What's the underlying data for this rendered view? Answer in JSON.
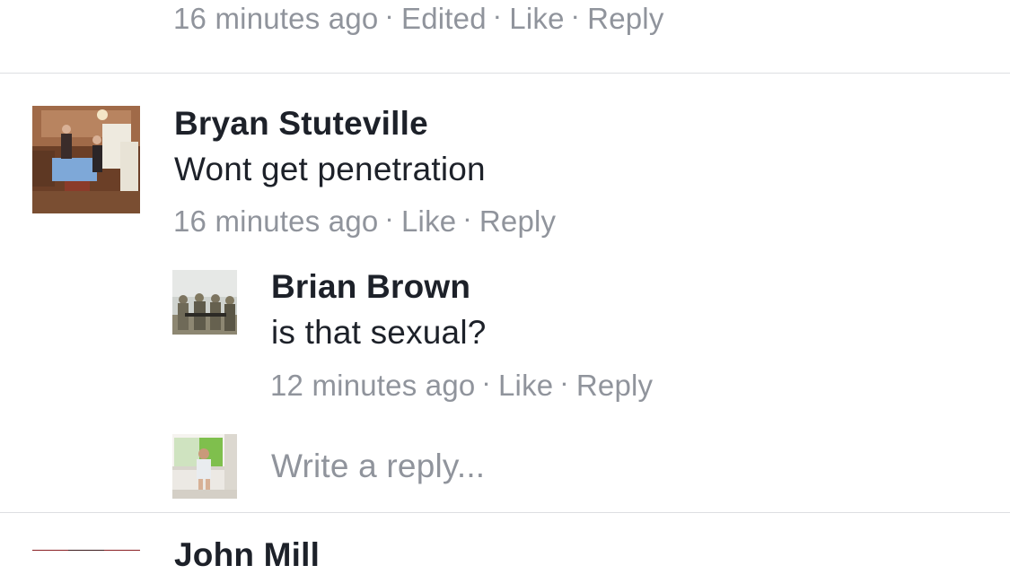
{
  "top_comment": {
    "time": "16 minutes ago",
    "edited": "Edited",
    "like": "Like",
    "reply": "Reply"
  },
  "comment": {
    "author": "Bryan Stuteville",
    "text": "Wont get penetration",
    "time": "16 minutes ago",
    "like": "Like",
    "reply": "Reply",
    "avatar_icon": "kitchen-photo-avatar"
  },
  "reply": {
    "author": "Brian Brown",
    "text": "is that sexual?",
    "time": "12 minutes ago",
    "like": "Like",
    "reply": "Reply",
    "avatar_icon": "soldiers-photo-avatar"
  },
  "reply_box": {
    "placeholder": "Write a reply...",
    "avatar_icon": "child-window-photo-avatar"
  },
  "next_comment": {
    "author_partial": "John Mill"
  },
  "colors": {
    "meta_text": "#90949c",
    "primary_text": "#1d2129",
    "divider": "#dddfe2"
  }
}
